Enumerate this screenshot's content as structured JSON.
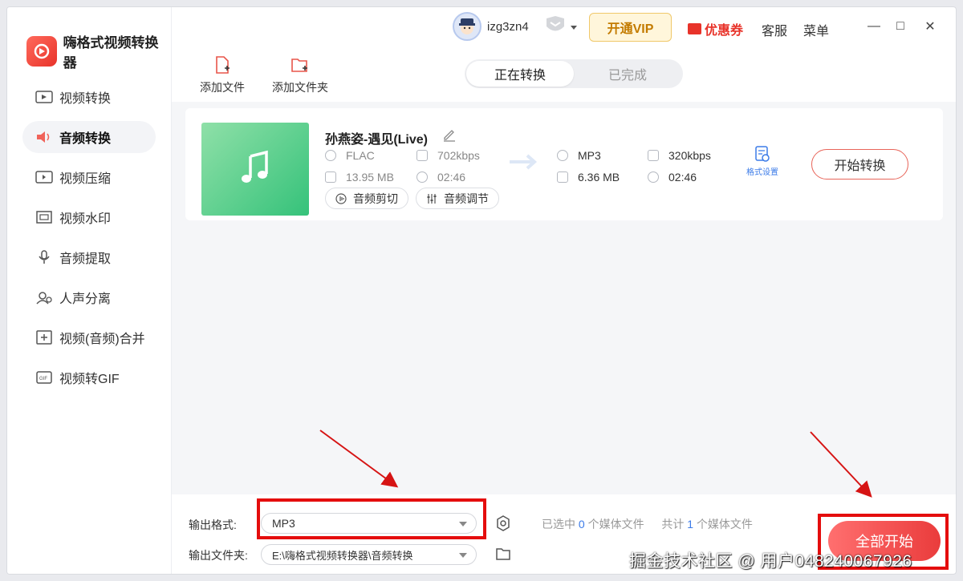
{
  "app": {
    "title": "嗨格式视频转换器"
  },
  "titlebar": {
    "username": "izg3zn4",
    "vip_label": "开通VIP",
    "coupon_label": "优惠券",
    "service_label": "客服",
    "menu_label": "菜单",
    "minimize": "—",
    "maximize": "□",
    "close": "✕"
  },
  "sidebar": {
    "items": [
      {
        "label": "视频转换",
        "icon": "video-convert-icon"
      },
      {
        "label": "音频转换",
        "icon": "audio-convert-icon",
        "active": true
      },
      {
        "label": "视频压缩",
        "icon": "video-compress-icon"
      },
      {
        "label": "视频水印",
        "icon": "video-watermark-icon"
      },
      {
        "label": "音频提取",
        "icon": "audio-extract-icon"
      },
      {
        "label": "人声分离",
        "icon": "vocal-separate-icon"
      },
      {
        "label": "视频(音频)合并",
        "icon": "merge-icon"
      },
      {
        "label": "视频转GIF",
        "icon": "gif-icon"
      }
    ]
  },
  "toolbar": {
    "add_file": "添加文件",
    "add_folder": "添加文件夹"
  },
  "tabs": {
    "converting": "正在转换",
    "completed": "已完成"
  },
  "file": {
    "name": "孙燕姿-遇见(Live)",
    "source": {
      "format": "FLAC",
      "bitrate": "702kbps",
      "size": "13.95 MB",
      "duration": "02:46"
    },
    "target": {
      "format": "MP3",
      "bitrate": "320kbps",
      "size": "6.36 MB",
      "duration": "02:46"
    },
    "audio_cut": "音频剪切",
    "audio_adjust": "音频调节",
    "format_settings": "格式设置",
    "start_label": "开始转换"
  },
  "bottom": {
    "output_format_label": "输出格式:",
    "output_format_value": "MP3",
    "output_folder_label": "输出文件夹:",
    "output_folder_value": "E:\\嗨格式视频转换器\\音频转换",
    "selected_prefix": "已选中",
    "selected_count": "0",
    "selected_suffix": "个媒体文件",
    "total_prefix": "共计",
    "total_count": "1",
    "total_suffix": "个媒体文件",
    "start_all_label": "全部开始"
  },
  "watermark": "掘金技术社区 @ 用户048240067926",
  "colors": {
    "accent": "#e8332a",
    "link": "#3b7be8",
    "annotation": "#e40d0d"
  }
}
